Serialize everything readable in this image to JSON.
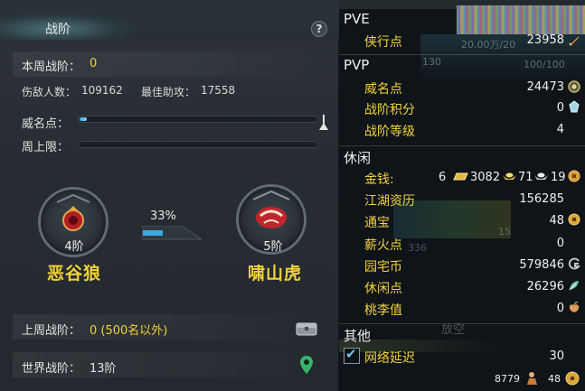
{
  "left_panel": {
    "title": "战阶",
    "help_label": "?",
    "this_week": {
      "label": "本周战阶：",
      "value": "0"
    },
    "kills": {
      "label": "伤敌人数：",
      "value": "109162"
    },
    "best_assist": {
      "label": "最佳助攻：",
      "value": "17558"
    },
    "fame_points": {
      "label": "威名点：",
      "progress": 0.03
    },
    "weekly_cap": {
      "label": "周上限：",
      "progress": 0.0
    },
    "left_badge": {
      "tier": "4阶",
      "faction": "恶谷狼"
    },
    "right_badge": {
      "tier": "5阶",
      "faction": "啸山虎"
    },
    "advance": {
      "percent_text": "33%",
      "progress": 0.33
    },
    "last_week": {
      "label": "上周战阶：",
      "value": "0 (500名以外)"
    },
    "world": {
      "label": "世界战阶：",
      "value": "13阶"
    }
  },
  "right_panel": {
    "pve": {
      "header": "PVE",
      "items": [
        {
          "label": "侠行点",
          "value": "23958",
          "icon": "sword-icon"
        }
      ]
    },
    "pvp": {
      "header": "PVP",
      "items": [
        {
          "label": "威名点",
          "value": "24473",
          "icon": "fame-icon"
        },
        {
          "label": "战阶积分",
          "value": "0",
          "icon": "crystal-icon"
        },
        {
          "label": "战阶等级",
          "value": "4"
        }
      ]
    },
    "leisure": {
      "header": "休闲",
      "money": {
        "label": "金钱:",
        "parts": [
          {
            "value": "6",
            "icon": "gold-bar-icon"
          },
          {
            "value": "3082",
            "icon": "gold-ingot-icon"
          },
          {
            "value": "71",
            "icon": "silver-ingot-icon"
          },
          {
            "value": "19",
            "icon": "copper-coin-icon"
          }
        ]
      },
      "items": [
        {
          "label": "江湖资历",
          "value": "156285"
        },
        {
          "label": "通宝",
          "value": "48",
          "icon": "coin-icon"
        },
        {
          "label": "薪火点",
          "value": "0"
        },
        {
          "label": "园宅币",
          "value": "579846",
          "icon": "home-coin-icon"
        },
        {
          "label": "休闲点",
          "value": "26296",
          "icon": "leaf-icon"
        },
        {
          "label": "桃李值",
          "value": "0",
          "icon": "peach-icon"
        }
      ]
    },
    "other": {
      "header": "其他",
      "network": {
        "label": "网络延迟",
        "value": "30",
        "checked": true
      }
    },
    "footer": {
      "left_value": "8779",
      "right_value": "48"
    },
    "background_text": {
      "amount": "20.00万/20",
      "level": "130",
      "hp": "100/100",
      "count_a": "336",
      "count_b": "15",
      "empty": "放空"
    }
  },
  "colors": {
    "accent_yellow": "#f2d23a",
    "progress_blue": "#3da8e6",
    "badge_red": "#c0262b"
  }
}
